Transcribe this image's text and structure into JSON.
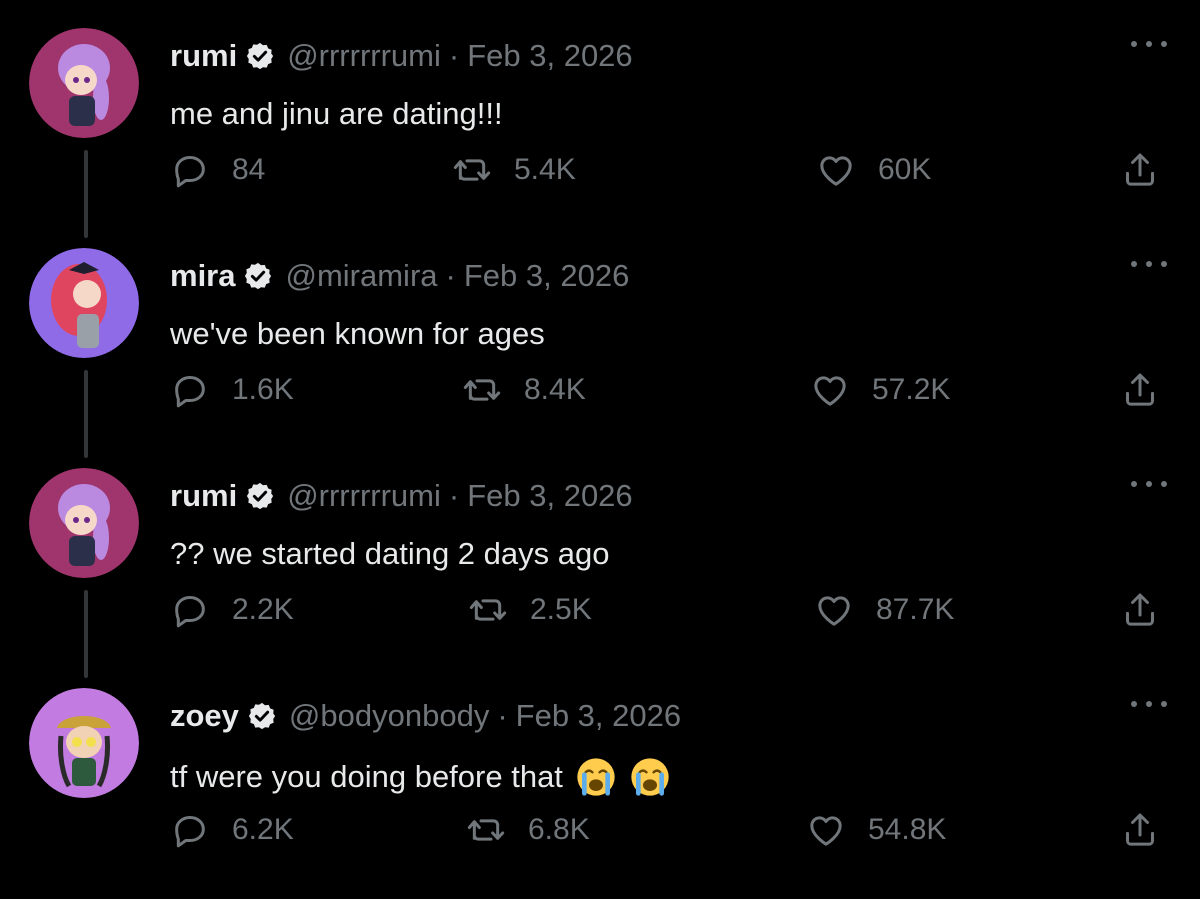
{
  "tweets": [
    {
      "name": "rumi",
      "handle": "@rrrrrrrumi",
      "separator": "·",
      "date": "Feb 3, 2026",
      "text": "me and jinu are dating!!!",
      "replies": "84",
      "retweets": "5.4K",
      "likes": "60K",
      "avatar_colors": {
        "bg": "#a0356e",
        "hair": "#b98ae0",
        "skin": "#f6d8c8",
        "outfit": "#2b2f4a"
      }
    },
    {
      "name": "mira",
      "handle": "@miramira",
      "separator": "·",
      "date": "Feb 3, 2026",
      "text": "we've been known for ages",
      "replies": "1.6K",
      "retweets": "8.4K",
      "likes": "57.2K",
      "avatar_colors": {
        "bg": "#8f6be8",
        "hair": "#e0455f",
        "skin": "#f6d8c8",
        "outfit": "#9aa0a8"
      }
    },
    {
      "name": "rumi",
      "handle": "@rrrrrrrumi",
      "separator": "·",
      "date": "Feb 3, 2026",
      "text": "?? we started dating 2 days ago",
      "replies": "2.2K",
      "retweets": "2.5K",
      "likes": "87.7K",
      "avatar_colors": {
        "bg": "#a0356e",
        "hair": "#b98ae0",
        "skin": "#f6d8c8",
        "outfit": "#2b2f4a"
      }
    },
    {
      "name": "zoey",
      "handle": "@bodyonbody",
      "separator": "·",
      "date": "Feb 3, 2026",
      "text": "tf were you doing before that",
      "emojis": [
        "loudly-crying-face",
        "loudly-crying-face"
      ],
      "replies": "6.2K",
      "retweets": "6.8K",
      "likes": "54.8K",
      "avatar_colors": {
        "bg": "#c27be0",
        "hair": "#2a2a2a",
        "skin": "#f2d2b4",
        "outfit": "#2d5a3c"
      }
    }
  ],
  "icons": {
    "reply": "reply-icon",
    "retweet": "retweet-icon",
    "like": "heart-icon",
    "share": "share-icon",
    "more": "more-icon",
    "verified": "verified-badge-icon"
  },
  "colors": {
    "background": "#000000",
    "primary_text": "#e7e9ea",
    "secondary_text": "#71767b",
    "thread_line": "#333639"
  }
}
